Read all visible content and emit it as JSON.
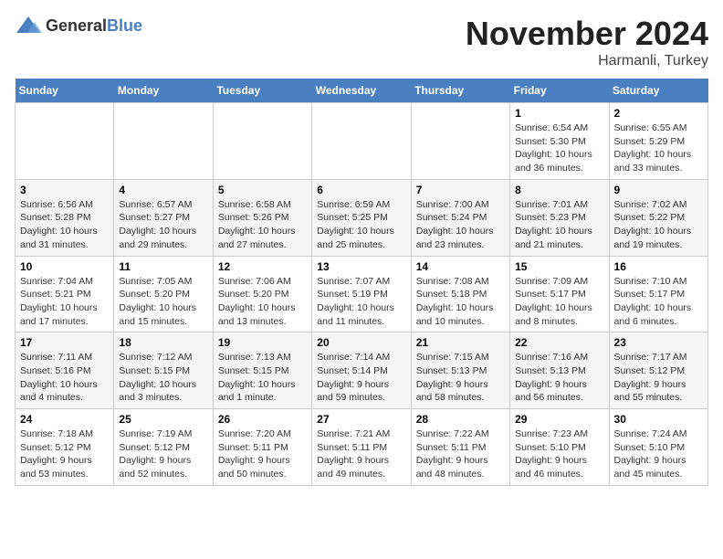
{
  "logo": {
    "general": "General",
    "blue": "Blue"
  },
  "header": {
    "month": "November 2024",
    "location": "Harmanli, Turkey"
  },
  "weekdays": [
    "Sunday",
    "Monday",
    "Tuesday",
    "Wednesday",
    "Thursday",
    "Friday",
    "Saturday"
  ],
  "weeks": [
    [
      {
        "day": "",
        "info": ""
      },
      {
        "day": "",
        "info": ""
      },
      {
        "day": "",
        "info": ""
      },
      {
        "day": "",
        "info": ""
      },
      {
        "day": "",
        "info": ""
      },
      {
        "day": "1",
        "info": "Sunrise: 6:54 AM\nSunset: 5:30 PM\nDaylight: 10 hours and 36 minutes."
      },
      {
        "day": "2",
        "info": "Sunrise: 6:55 AM\nSunset: 5:29 PM\nDaylight: 10 hours and 33 minutes."
      }
    ],
    [
      {
        "day": "3",
        "info": "Sunrise: 6:56 AM\nSunset: 5:28 PM\nDaylight: 10 hours and 31 minutes."
      },
      {
        "day": "4",
        "info": "Sunrise: 6:57 AM\nSunset: 5:27 PM\nDaylight: 10 hours and 29 minutes."
      },
      {
        "day": "5",
        "info": "Sunrise: 6:58 AM\nSunset: 5:26 PM\nDaylight: 10 hours and 27 minutes."
      },
      {
        "day": "6",
        "info": "Sunrise: 6:59 AM\nSunset: 5:25 PM\nDaylight: 10 hours and 25 minutes."
      },
      {
        "day": "7",
        "info": "Sunrise: 7:00 AM\nSunset: 5:24 PM\nDaylight: 10 hours and 23 minutes."
      },
      {
        "day": "8",
        "info": "Sunrise: 7:01 AM\nSunset: 5:23 PM\nDaylight: 10 hours and 21 minutes."
      },
      {
        "day": "9",
        "info": "Sunrise: 7:02 AM\nSunset: 5:22 PM\nDaylight: 10 hours and 19 minutes."
      }
    ],
    [
      {
        "day": "10",
        "info": "Sunrise: 7:04 AM\nSunset: 5:21 PM\nDaylight: 10 hours and 17 minutes."
      },
      {
        "day": "11",
        "info": "Sunrise: 7:05 AM\nSunset: 5:20 PM\nDaylight: 10 hours and 15 minutes."
      },
      {
        "day": "12",
        "info": "Sunrise: 7:06 AM\nSunset: 5:20 PM\nDaylight: 10 hours and 13 minutes."
      },
      {
        "day": "13",
        "info": "Sunrise: 7:07 AM\nSunset: 5:19 PM\nDaylight: 10 hours and 11 minutes."
      },
      {
        "day": "14",
        "info": "Sunrise: 7:08 AM\nSunset: 5:18 PM\nDaylight: 10 hours and 10 minutes."
      },
      {
        "day": "15",
        "info": "Sunrise: 7:09 AM\nSunset: 5:17 PM\nDaylight: 10 hours and 8 minutes."
      },
      {
        "day": "16",
        "info": "Sunrise: 7:10 AM\nSunset: 5:17 PM\nDaylight: 10 hours and 6 minutes."
      }
    ],
    [
      {
        "day": "17",
        "info": "Sunrise: 7:11 AM\nSunset: 5:16 PM\nDaylight: 10 hours and 4 minutes."
      },
      {
        "day": "18",
        "info": "Sunrise: 7:12 AM\nSunset: 5:15 PM\nDaylight: 10 hours and 3 minutes."
      },
      {
        "day": "19",
        "info": "Sunrise: 7:13 AM\nSunset: 5:15 PM\nDaylight: 10 hours and 1 minute."
      },
      {
        "day": "20",
        "info": "Sunrise: 7:14 AM\nSunset: 5:14 PM\nDaylight: 9 hours and 59 minutes."
      },
      {
        "day": "21",
        "info": "Sunrise: 7:15 AM\nSunset: 5:13 PM\nDaylight: 9 hours and 58 minutes."
      },
      {
        "day": "22",
        "info": "Sunrise: 7:16 AM\nSunset: 5:13 PM\nDaylight: 9 hours and 56 minutes."
      },
      {
        "day": "23",
        "info": "Sunrise: 7:17 AM\nSunset: 5:12 PM\nDaylight: 9 hours and 55 minutes."
      }
    ],
    [
      {
        "day": "24",
        "info": "Sunrise: 7:18 AM\nSunset: 5:12 PM\nDaylight: 9 hours and 53 minutes."
      },
      {
        "day": "25",
        "info": "Sunrise: 7:19 AM\nSunset: 5:12 PM\nDaylight: 9 hours and 52 minutes."
      },
      {
        "day": "26",
        "info": "Sunrise: 7:20 AM\nSunset: 5:11 PM\nDaylight: 9 hours and 50 minutes."
      },
      {
        "day": "27",
        "info": "Sunrise: 7:21 AM\nSunset: 5:11 PM\nDaylight: 9 hours and 49 minutes."
      },
      {
        "day": "28",
        "info": "Sunrise: 7:22 AM\nSunset: 5:11 PM\nDaylight: 9 hours and 48 minutes."
      },
      {
        "day": "29",
        "info": "Sunrise: 7:23 AM\nSunset: 5:10 PM\nDaylight: 9 hours and 46 minutes."
      },
      {
        "day": "30",
        "info": "Sunrise: 7:24 AM\nSunset: 5:10 PM\nDaylight: 9 hours and 45 minutes."
      }
    ]
  ]
}
